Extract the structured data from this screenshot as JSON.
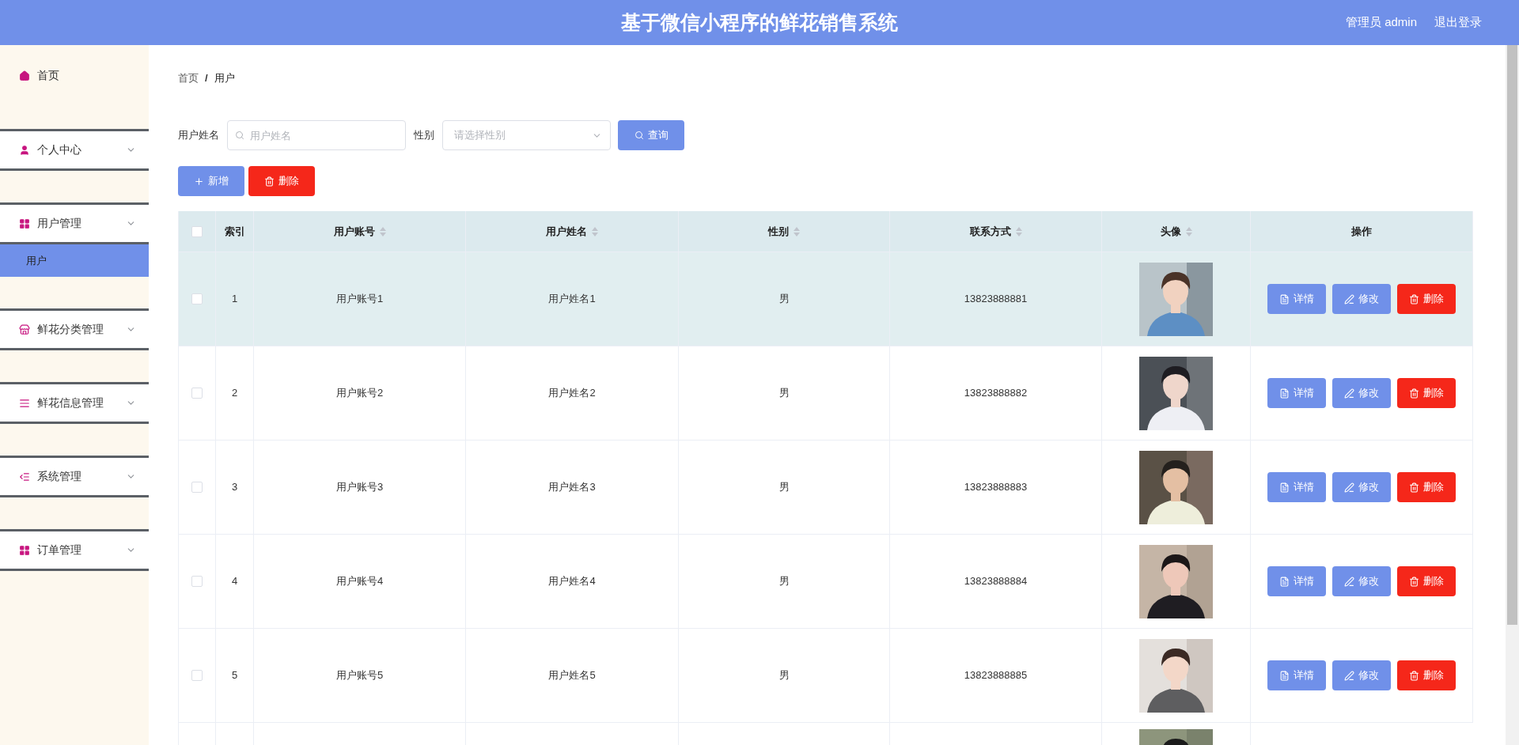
{
  "header": {
    "title": "基于微信小程序的鲜花销售系统",
    "user": "管理员 admin",
    "logout": "退出登录"
  },
  "sidebar": {
    "items": [
      {
        "kind": "link",
        "label": "首页"
      },
      {
        "kind": "group",
        "label": "个人中心"
      },
      {
        "kind": "group",
        "label": "用户管理",
        "children": [
          {
            "label": "用户",
            "selected": true
          }
        ]
      },
      {
        "kind": "group",
        "label": "鲜花分类管理"
      },
      {
        "kind": "group",
        "label": "鲜花信息管理"
      },
      {
        "kind": "group",
        "label": "系统管理"
      },
      {
        "kind": "group",
        "label": "订单管理"
      }
    ]
  },
  "breadcrumb": {
    "items": [
      "首页",
      "用户"
    ],
    "separator": "/"
  },
  "search": {
    "name_label": "用户姓名",
    "name_placeholder": "用户姓名",
    "gender_label": "性别",
    "gender_placeholder": "请选择性别",
    "button": "查询"
  },
  "toolbar": [
    {
      "kind": "add",
      "label": "新增"
    },
    {
      "kind": "delete",
      "label": "删除"
    }
  ],
  "table": {
    "all_checked": false,
    "columns": [
      {
        "label": "索引",
        "sortable": false
      },
      {
        "label": "用户账号",
        "sortable": true
      },
      {
        "label": "用户姓名",
        "sortable": true
      },
      {
        "label": "性别",
        "sortable": true
      },
      {
        "label": "联系方式",
        "sortable": true
      },
      {
        "label": "头像",
        "sortable": true
      },
      {
        "label": "操作",
        "sortable": false
      }
    ],
    "rows": [
      {
        "kind": "full",
        "highlighted": true,
        "checked": false,
        "index": "1",
        "account": "用户账号1",
        "name": "用户姓名1",
        "gender": "男",
        "phone": "13823888881",
        "actions": [
          {
            "kind": "detail",
            "label": "详情"
          },
          {
            "kind": "edit",
            "label": "修改"
          },
          {
            "kind": "delete",
            "label": "删除"
          }
        ]
      },
      {
        "kind": "full",
        "highlighted": false,
        "checked": false,
        "index": "2",
        "account": "用户账号2",
        "name": "用户姓名2",
        "gender": "男",
        "phone": "13823888882",
        "actions": [
          {
            "kind": "detail",
            "label": "详情"
          },
          {
            "kind": "edit",
            "label": "修改"
          },
          {
            "kind": "delete",
            "label": "删除"
          }
        ]
      },
      {
        "kind": "full",
        "highlighted": false,
        "checked": false,
        "index": "3",
        "account": "用户账号3",
        "name": "用户姓名3",
        "gender": "男",
        "phone": "13823888883",
        "actions": [
          {
            "kind": "detail",
            "label": "详情"
          },
          {
            "kind": "edit",
            "label": "修改"
          },
          {
            "kind": "delete",
            "label": "删除"
          }
        ]
      },
      {
        "kind": "full",
        "highlighted": false,
        "checked": false,
        "index": "4",
        "account": "用户账号4",
        "name": "用户姓名4",
        "gender": "男",
        "phone": "13823888884",
        "actions": [
          {
            "kind": "detail",
            "label": "详情"
          },
          {
            "kind": "edit",
            "label": "修改"
          },
          {
            "kind": "delete",
            "label": "删除"
          }
        ]
      },
      {
        "kind": "full",
        "highlighted": false,
        "checked": false,
        "index": "5",
        "account": "用户账号5",
        "name": "用户姓名5",
        "gender": "男",
        "phone": "13823888885",
        "actions": [
          {
            "kind": "detail",
            "label": "详情"
          },
          {
            "kind": "edit",
            "label": "修改"
          },
          {
            "kind": "delete",
            "label": "删除"
          }
        ]
      },
      {
        "kind": "partial"
      }
    ]
  }
}
